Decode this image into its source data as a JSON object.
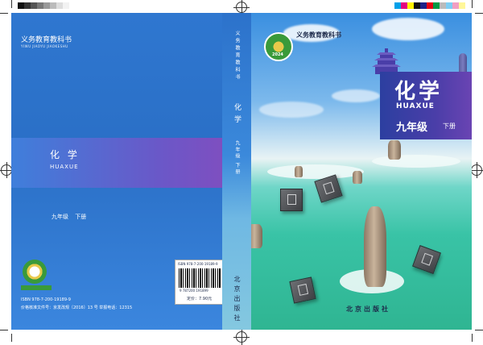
{
  "back_cover": {
    "series_cn": "义务教育教科书",
    "series_pinyin": "YIWU JIAOYU JIAOKESHU",
    "title_cn": "化 学",
    "title_pinyin": "HUAXUE",
    "grade": "九年级",
    "volume": "下册",
    "isbn": "ISBN 978-7-200-19189-9",
    "approval": "价格核准文件号：京发改规〔2016〕13 号  举报电话：12315"
  },
  "barcode": {
    "isbn_small": "ISBN 978-7-200-19189-9",
    "digits": "9 787200 191899",
    "price": "定价：7.90元"
  },
  "spine": {
    "series": "义务教育教科书",
    "subject": "化学",
    "grade_volume": "九年级 下册",
    "publisher": "北京出版社"
  },
  "front_cover": {
    "series": "义务教育教科书",
    "badge_year": "2024",
    "title_cn": "化学",
    "title_pinyin": "HUAXUE",
    "grade": "九年级",
    "volume": "下册",
    "publisher": "北京出版社"
  },
  "colors": {
    "back_blue": "#2f77d0",
    "band_purple": "#6a58c8",
    "title_band": "#4a3ea8",
    "lake_green": "#39c3a6",
    "badge_green": "#3a9a3a"
  }
}
